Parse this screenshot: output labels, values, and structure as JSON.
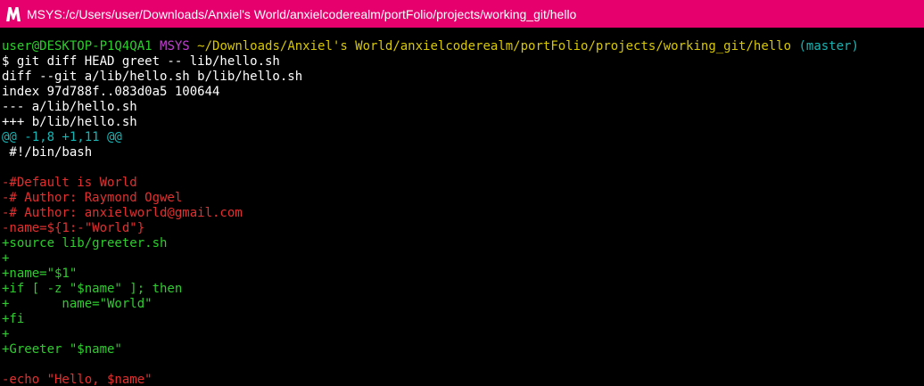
{
  "window": {
    "title": "MSYS:/c/Users/user/Downloads/Anxiel's World/anxielcoderealm/portFolio/projects/working_git/hello",
    "titlebar_color": "#e6006e",
    "icon": "msys-m-icon"
  },
  "colors": {
    "background": "#000000",
    "default_text": "#ffffff",
    "prompt_user": "#2ecc2e",
    "prompt_msys": "#c040d0",
    "prompt_path": "#d8c800",
    "prompt_branch": "#18b5b5",
    "hunk": "#18b5b5",
    "removed": "#e03030",
    "added": "#2ecc2e"
  },
  "terminal": {
    "lines": [
      {
        "type": "prompt",
        "segments": [
          {
            "text": "user@DESKTOP-P1Q4QA1",
            "color": "prompt_user"
          },
          {
            "text": " ",
            "color": "default_text"
          },
          {
            "text": "MSYS",
            "color": "prompt_msys"
          },
          {
            "text": " ",
            "color": "default_text"
          },
          {
            "text": "~/Downloads/Anxiel's World/anxielcoderealm/portFolio/projects/working_git/hello",
            "color": "prompt_path"
          },
          {
            "text": " ",
            "color": "default_text"
          },
          {
            "text": "(master)",
            "color": "prompt_branch"
          }
        ]
      },
      {
        "type": "command",
        "segments": [
          {
            "text": "$ git diff HEAD greet -- lib/hello.sh",
            "color": "default_text"
          }
        ]
      },
      {
        "type": "header",
        "segments": [
          {
            "text": "diff --git a/lib/hello.sh b/lib/hello.sh",
            "color": "default_text"
          }
        ]
      },
      {
        "type": "header",
        "segments": [
          {
            "text": "index 97d788f..083d0a5 100644",
            "color": "default_text"
          }
        ]
      },
      {
        "type": "header",
        "segments": [
          {
            "text": "--- a/lib/hello.sh",
            "color": "default_text"
          }
        ]
      },
      {
        "type": "header",
        "segments": [
          {
            "text": "+++ b/lib/hello.sh",
            "color": "default_text"
          }
        ]
      },
      {
        "type": "hunk",
        "segments": [
          {
            "text": "@@ -1,8 +1,11 @@",
            "color": "hunk"
          }
        ]
      },
      {
        "type": "context",
        "segments": [
          {
            "text": " #!/bin/bash",
            "color": "default_text"
          }
        ]
      },
      {
        "type": "context",
        "segments": [
          {
            "text": "",
            "color": "default_text"
          }
        ]
      },
      {
        "type": "removed",
        "segments": [
          {
            "text": "-#Default is World",
            "color": "removed"
          }
        ]
      },
      {
        "type": "removed",
        "segments": [
          {
            "text": "-# Author: Raymond Ogwel",
            "color": "removed"
          }
        ]
      },
      {
        "type": "removed",
        "segments": [
          {
            "text": "-# Author: anxielworld@gmail.com",
            "color": "removed"
          }
        ]
      },
      {
        "type": "removed",
        "segments": [
          {
            "text": "-name=${1:-\"World\"}",
            "color": "removed"
          }
        ]
      },
      {
        "type": "added",
        "segments": [
          {
            "text": "+source lib/greeter.sh",
            "color": "added"
          }
        ]
      },
      {
        "type": "added",
        "segments": [
          {
            "text": "+",
            "color": "added"
          }
        ]
      },
      {
        "type": "added",
        "segments": [
          {
            "text": "+name=\"$1\"",
            "color": "added"
          }
        ]
      },
      {
        "type": "added",
        "segments": [
          {
            "text": "+if [ -z \"$name\" ]; then",
            "color": "added"
          }
        ]
      },
      {
        "type": "added",
        "segments": [
          {
            "text": "+       name=\"World\"",
            "color": "added"
          }
        ]
      },
      {
        "type": "added",
        "segments": [
          {
            "text": "+fi",
            "color": "added"
          }
        ]
      },
      {
        "type": "added",
        "segments": [
          {
            "text": "+",
            "color": "added"
          }
        ]
      },
      {
        "type": "added",
        "segments": [
          {
            "text": "+Greeter \"$name\"",
            "color": "added"
          }
        ]
      },
      {
        "type": "context",
        "segments": [
          {
            "text": "",
            "color": "default_text"
          }
        ]
      },
      {
        "type": "removed",
        "segments": [
          {
            "text": "-echo \"Hello, $name\"",
            "color": "removed"
          }
        ]
      }
    ]
  }
}
